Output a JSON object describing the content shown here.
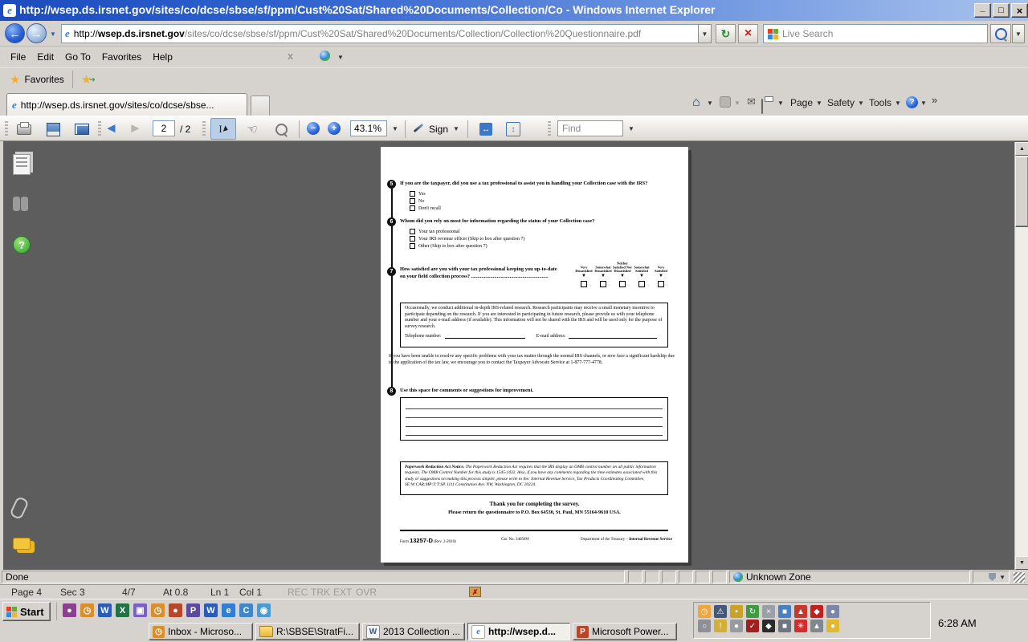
{
  "window": {
    "title": "http://wsep.ds.irsnet.gov/sites/co/dcse/sbse/sf/ppm/Cust%20Sat/Shared%20Documents/Collection/Co - Windows Internet Explorer"
  },
  "icons": {
    "back": "←",
    "forward": "→",
    "down": "▼",
    "up": "▲",
    "star": "★",
    "mail": "✉",
    "home": "⌂",
    "chevron_more": "»",
    "refresh": "↻",
    "stop": "×",
    "minimize": "_",
    "maximize": "□",
    "close": "×",
    "help": "?",
    "ie": "e",
    "select_tool": "I",
    "hand_tool": "☜",
    "left_chunky": "◄",
    "right_chunky": "►"
  },
  "address_bar": {
    "url_scheme": "http://",
    "url_domain": "wsep.ds.irsnet.gov",
    "url_path": "/sites/co/dcse/sbse/sf/ppm/Cust%20Sat/Shared%20Documents/Collection/Collection%20Questionnaire.pdf",
    "search_placeholder": "Live Search"
  },
  "menu": {
    "items": [
      "File",
      "Edit",
      "Go To",
      "Favorites",
      "Help"
    ]
  },
  "favorites_bar": {
    "label": "Favorites"
  },
  "tab": {
    "title": "http://wsep.ds.irsnet.gov/sites/co/dcse/sbse..."
  },
  "command_bar": {
    "page": "Page",
    "safety": "Safety",
    "tools": "Tools"
  },
  "pdf_toolbar": {
    "page_value": "2",
    "page_total": "/ 2",
    "zoom_value": "43.1%",
    "sign_label": "Sign",
    "find_label": "Find"
  },
  "document": {
    "q5": {
      "number": "5",
      "text": "If you are the taxpayer, did you use a tax professional to assist you in handling your Collection case with the IRS?",
      "options": [
        "Yes",
        "No",
        "Don't recall"
      ]
    },
    "q6": {
      "number": "6",
      "text": "Whom did you rely on most for information regarding the status of your Collection case?",
      "options": [
        "Your tax professional",
        "Your IRS revenue officer (Skip to box after question 7)",
        "Other (Skip to box after question 7)"
      ]
    },
    "scale": [
      "Very Dissatisfied",
      "Somewhat Dissatisfied",
      "Neither Satisfied Nor Dissatisfied",
      "Somewhat Satisfied",
      "Very Satisfied"
    ],
    "q7": {
      "number": "7",
      "line1": "How satisfied are you with your tax professional keeping you up-to-date",
      "line2": "on your field collection process? ............................................................"
    },
    "research_box": {
      "text": "Occasionally, we conduct additional in-depth IRS-related research. Research participants may receive a small monetary incentive to participate depending on the research. If you are interested in participating in future research, please provide us with your telephone number and your e-mail address (if available). This information will not be shared with the IRS and will be used only for the purpose of survey research.",
      "phone_label": "Telephone number:",
      "email_label": "E-mail address:"
    },
    "advocate_text": "If you have been unable to resolve any specific problems with your tax matter through the normal IRS channels, or now face a significant hardship due to the application of the tax law, we encourage you to contact the Taxpayer Advocate Service at 1-877-777-4778.",
    "q8": {
      "number": "8",
      "text": "Use this space for comments or suggestions for improvement."
    },
    "pra_bold": "Paperwork Reduction Act Notice.",
    "pra_rest": "  The Paperwork Reduction Act requires that the IRS display an OMB control number on all public information requests. The OMB Control Number for this study is 1545-1432. Also, if you have any comments regarding the time estimates associated with this study or suggestions on making this process simpler, please write to the: Internal Revenue Service, Tax Products Coordinating Committee, SE:W:CAR:MP:T:T:SP, 1111 Constitution Ave. NW, Washington, DC 20224.",
    "thanks": "Thank you for completing the survey.",
    "return_line": "Please return the questionnaire to P.O. Box 64530, St. Paul, MN 55164-9610 USA.",
    "footer": {
      "form_label": "Form",
      "form_number": "13257-D",
      "form_rev": "(Rev. 2-2010)",
      "catalog": "Cat. No. 34058W",
      "dept": "Department of the Treasury – ",
      "dept_bold": "Internal Revenue Service"
    }
  },
  "status_bar": {
    "done": "Done",
    "zone": "Unknown Zone"
  },
  "word_status": {
    "items": [
      "Page 4",
      "Sec 3",
      "4/7",
      "At 0.8",
      "Ln 1",
      "Col 1"
    ],
    "modes": [
      "REC",
      "TRK",
      "EXT",
      "OVR"
    ]
  },
  "taskbar": {
    "start_label": "Start",
    "clock": "6:28 AM",
    "tasks": [
      {
        "label": "Inbox - Microso...",
        "icon": "outlook-task-icon"
      },
      {
        "label": "R:\\SBSE\\StratFi...",
        "icon": "folder-task-icon"
      },
      {
        "label": "2013 Collection ...",
        "icon": "word-doc-task-icon"
      },
      {
        "label": "http://wsep.d...",
        "icon": "ie-task-icon",
        "active": true
      },
      {
        "label": "Microsoft Power...",
        "icon": "powerpoint-task-icon"
      }
    ],
    "quick_launch": [
      {
        "name": "ql-communicator-icon",
        "bg": "#8b3f8f",
        "glyph": "●"
      },
      {
        "name": "ql-outlook-icon",
        "bg": "#d98f2b",
        "glyph": "◷"
      },
      {
        "name": "ql-word-icon",
        "bg": "#2a5bb8",
        "glyph": "W"
      },
      {
        "name": "ql-excel-icon",
        "bg": "#217346",
        "glyph": "X"
      },
      {
        "name": "ql-remote-icon",
        "bg": "#7b5ec7",
        "glyph": "▣"
      },
      {
        "name": "ql-calendar-icon",
        "bg": "#d98f2b",
        "glyph": "◷"
      },
      {
        "name": "ql-powerpoint-icon",
        "bg": "#b7472a",
        "glyph": "●"
      },
      {
        "name": "ql-publisher-icon",
        "bg": "#5c4a9e",
        "glyph": "P"
      },
      {
        "name": "ql-word2-icon",
        "bg": "#2a5bb8",
        "glyph": "W"
      },
      {
        "name": "ql-ie-icon",
        "bg": "#2f7fd6",
        "glyph": "e"
      },
      {
        "name": "ql-outlook-express-icon",
        "bg": "#3f87c9",
        "glyph": "C"
      },
      {
        "name": "ql-msn-icon",
        "bg": "#4a9bd4",
        "glyph": "◉"
      }
    ],
    "tray_row1": [
      {
        "name": "tray-clock-icon",
        "bg": "#f0a640",
        "glyph": "◷"
      },
      {
        "name": "tray-monitor-alert-icon",
        "bg": "#44597a",
        "glyph": "⚠"
      },
      {
        "name": "tray-lock-icon",
        "bg": "#c9a227",
        "glyph": "▪"
      },
      {
        "name": "tray-sync-icon",
        "bg": "#3f9b41",
        "glyph": "↻"
      },
      {
        "name": "tray-pc-error-icon",
        "bg": "#9aa0a8",
        "glyph": "×"
      },
      {
        "name": "tray-dual-monitor-icon",
        "bg": "#4a7fc1",
        "glyph": "■"
      },
      {
        "name": "tray-alert-icon",
        "bg": "#c23b2e",
        "glyph": "▲"
      },
      {
        "name": "tray-flame-icon",
        "bg": "#c22020",
        "glyph": "◆"
      },
      {
        "name": "tray-launcher-icon",
        "bg": "#7d86a8",
        "glyph": "●"
      }
    ],
    "tray_row2": [
      {
        "name": "tray-volume-icon",
        "bg": "#8f8f98",
        "glyph": "○"
      },
      {
        "name": "tray-key-icon",
        "bg": "#d4af37",
        "glyph": "!"
      },
      {
        "name": "tray-mouse-icon",
        "bg": "#9a9aa2",
        "glyph": "●"
      },
      {
        "name": "tray-antivirus-icon",
        "bg": "#a02020",
        "glyph": "✓"
      },
      {
        "name": "tray-gold-icon",
        "bg": "#2b2b2b",
        "glyph": "◆"
      },
      {
        "name": "tray-display-icon",
        "bg": "#6f7680",
        "glyph": "■"
      },
      {
        "name": "tray-snowflake-icon",
        "bg": "#cf2f2f",
        "glyph": "✳"
      },
      {
        "name": "tray-satellite-icon",
        "bg": "#7f8890",
        "glyph": "▲"
      },
      {
        "name": "tray-badge-icon",
        "bg": "#e0b92f",
        "glyph": "●"
      }
    ]
  }
}
